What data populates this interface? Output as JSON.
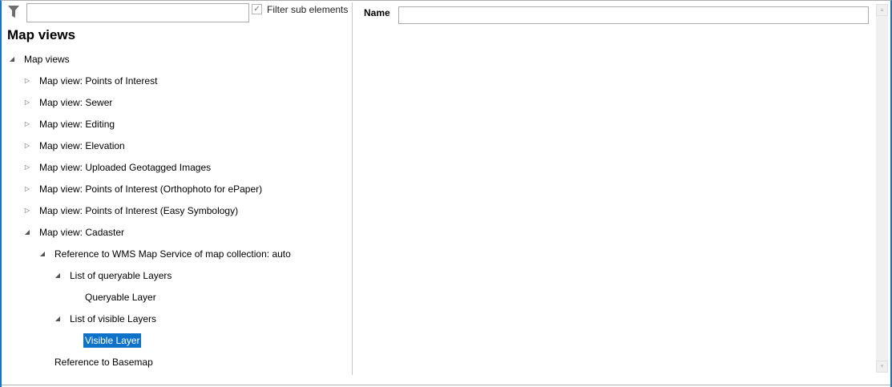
{
  "filter": {
    "value": "",
    "checkbox_label": "Filter sub elements",
    "checked": true
  },
  "title": "Map views",
  "tree": [
    {
      "label": "Map views",
      "level": 0,
      "state": "expanded"
    },
    {
      "label": "Map view: Points of Interest",
      "level": 1,
      "state": "collapsed"
    },
    {
      "label": "Map view: Sewer",
      "level": 1,
      "state": "collapsed"
    },
    {
      "label": "Map view: Editing",
      "level": 1,
      "state": "collapsed"
    },
    {
      "label": "Map view: Elevation",
      "level": 1,
      "state": "collapsed"
    },
    {
      "label": "Map view: Uploaded Geotagged Images",
      "level": 1,
      "state": "collapsed"
    },
    {
      "label": "Map view: Points of Interest (Orthophoto for ePaper)",
      "level": 1,
      "state": "collapsed"
    },
    {
      "label": "Map view: Points of Interest (Easy Symbology)",
      "level": 1,
      "state": "collapsed"
    },
    {
      "label": "Map view: Cadaster",
      "level": 1,
      "state": "expanded"
    },
    {
      "label": "Reference to WMS Map Service of map collection: auto",
      "level": 2,
      "state": "expanded"
    },
    {
      "label": "List of queryable Layers",
      "level": 3,
      "state": "expanded"
    },
    {
      "label": "Queryable Layer",
      "level": 4,
      "state": "leaf"
    },
    {
      "label": "List of visible Layers",
      "level": 3,
      "state": "expanded"
    },
    {
      "label": "Visible Layer",
      "level": 4,
      "state": "leaf",
      "selected": true
    },
    {
      "label": "Reference to Basemap",
      "level": 2,
      "state": "leaf"
    }
  ],
  "details": {
    "name_label": "Name",
    "name_value": ""
  },
  "colors": {
    "selection": "#0e72c9",
    "window_border": "#1a73c8"
  }
}
